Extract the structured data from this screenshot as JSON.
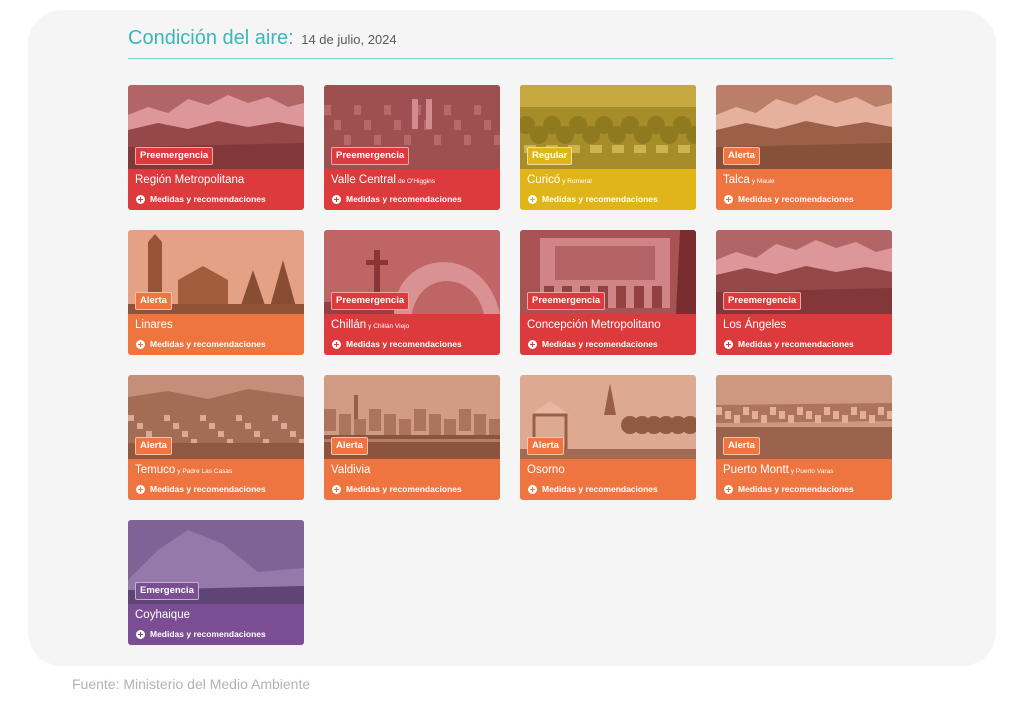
{
  "header": {
    "title": "Condición del aire:",
    "date": "14 de julio, 2024"
  },
  "link_label": "Medidas y recomendaciones",
  "level_colors": {
    "Preemergencia": "#dc3a3d",
    "Regular": "#e0b51a",
    "Alerta": "#ee7440",
    "Emergencia": "#7b4e93"
  },
  "cards": [
    {
      "status": "Preemergencia",
      "city": "Región Metropolitana",
      "sub": "",
      "image": "mountains-city"
    },
    {
      "status": "Preemergencia",
      "city": "Valle Central",
      "sub": "de O'Higgins",
      "image": "aerial-town"
    },
    {
      "status": "Regular",
      "city": "Curicó",
      "sub": "y Romeral",
      "image": "aerial-trees"
    },
    {
      "status": "Alerta",
      "city": "Talca",
      "sub": "y Maule",
      "image": "mountains-city"
    },
    {
      "status": "Alerta",
      "city": "Linares",
      "sub": "",
      "image": "church-tower"
    },
    {
      "status": "Preemergencia",
      "city": "Chillán",
      "sub": "y Chillán Viejo",
      "image": "arch-monument"
    },
    {
      "status": "Preemergencia",
      "city": "Concepción Metropolitano",
      "sub": "",
      "image": "mural-building"
    },
    {
      "status": "Preemergencia",
      "city": "Los Ángeles",
      "sub": "",
      "image": "mountains-city"
    },
    {
      "status": "Alerta",
      "city": "Temuco",
      "sub": "y Padre Las Casas",
      "image": "city-hills"
    },
    {
      "status": "Alerta",
      "city": "Valdivia",
      "sub": "",
      "image": "waterfront"
    },
    {
      "status": "Alerta",
      "city": "Osorno",
      "sub": "",
      "image": "plaza-kiosk"
    },
    {
      "status": "Alerta",
      "city": "Puerto Montt",
      "sub": "y Puerto Varas",
      "image": "bay-city"
    },
    {
      "status": "Emergencia",
      "city": "Coyhaique",
      "sub": "",
      "image": "mountain-peak"
    }
  ],
  "source": "Fuente: Ministerio del Medio Ambiente"
}
